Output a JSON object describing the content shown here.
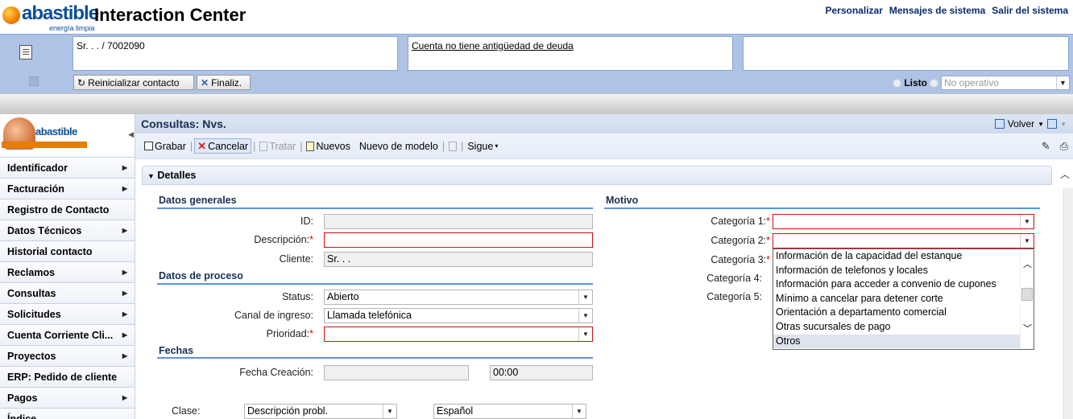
{
  "header": {
    "brand": "abastible",
    "tagline": "energía limpia",
    "app_title": "Interaction Center",
    "links": [
      "Personalizar",
      "Mensajes de sistema",
      "Salir del sistema"
    ]
  },
  "contact": {
    "customer": "Sr. . . / 7002090",
    "debt_note": "Cuenta no tiene antigüedad de deuda",
    "third": "",
    "reset_label": "Reinicializar contacto",
    "finish_label": "Finaliz.",
    "status_ready": "Listo",
    "status_value": "No operativo"
  },
  "nav": {
    "logo_text": "abastible",
    "items": [
      {
        "label": "Identificador",
        "arrow": true
      },
      {
        "label": "Facturación",
        "arrow": true
      },
      {
        "label": "Registro de Contacto",
        "arrow": false
      },
      {
        "label": "Datos Técnicos",
        "arrow": true
      },
      {
        "label": "Historial contacto",
        "arrow": false
      },
      {
        "label": "Reclamos",
        "arrow": true
      },
      {
        "label": "Consultas",
        "arrow": true
      },
      {
        "label": "Solicitudes",
        "arrow": true
      },
      {
        "label": "Cuenta Corriente Cli...",
        "arrow": true
      },
      {
        "label": "Proyectos",
        "arrow": true
      },
      {
        "label": "ERP: Pedido de cliente",
        "arrow": false
      },
      {
        "label": "Pagos",
        "arrow": true
      },
      {
        "label": "Índice",
        "arrow": false
      }
    ]
  },
  "main": {
    "title": "Consultas: Nvs.",
    "back_label": "Volver",
    "toolbar": {
      "save": "Grabar",
      "cancel": "Cancelar",
      "process": "Tratar",
      "new": "Nuevos",
      "new_model": "Nuevo de modelo",
      "next": "Sigue"
    },
    "section_title": "Detalles",
    "general": {
      "title": "Datos generales",
      "id_label": "ID:",
      "id_value": "",
      "desc_label": "Descripción:",
      "desc_value": "",
      "client_label": "Cliente:",
      "client_value": "Sr. . ."
    },
    "process": {
      "title": "Datos de proceso",
      "status_label": "Status:",
      "status_value": "Abierto",
      "channel_label": "Canal de ingreso:",
      "channel_value": "Llamada telefónica",
      "priority_label": "Prioridad:",
      "priority_value": ""
    },
    "dates": {
      "title": "Fechas",
      "created_label": "Fecha Creación:",
      "created_value": "",
      "created_time": "00:00"
    },
    "bottom": {
      "class_label": "Clase:",
      "class_value": "Descripción probl.",
      "lang_value": "Español"
    },
    "motive": {
      "title": "Motivo",
      "cat1_label": "Categoría 1:",
      "cat2_label": "Categoría 2:",
      "cat3_label": "Categoría 3:",
      "cat4_label": "Categoría 4:",
      "cat5_label": "Categoría 5:",
      "options": [
        "Información de la capacidad del estanque",
        "Información de telefonos y locales",
        "Información para acceder a convenio de cupones",
        "Mínimo a cancelar para detener corte",
        "Orientación a departamento comercial",
        "Otras sucursales de pago",
        "Otros"
      ],
      "selected_option": "Otros"
    }
  }
}
